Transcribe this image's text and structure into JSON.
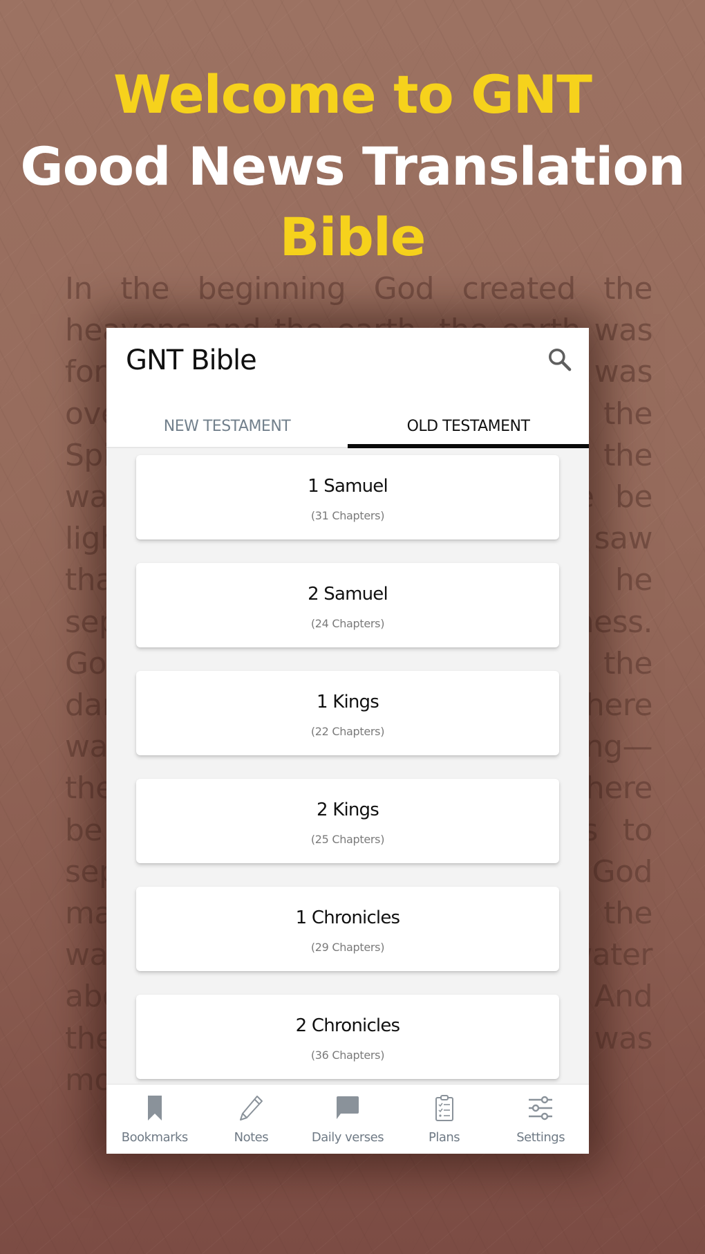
{
  "promo": {
    "line1": "Welcome to GNT",
    "line2": "Good News Translation",
    "line3": "Bible",
    "accent_color": "#f6d21c",
    "background_verse": "In the beginning God created the heavens and the earth, the earth was formless and empty, darkness was over the surface of the deep, and the Spirit of God was hovering over the waters. And God said, Let there be light, and there was light. God saw that the light was good, and he separated the light from the darkness. God called the light day, and the darkness he called night. And there was evening, and there was morning—the first day. And God said, Let there be a vault between the waters to separate water from water. So God made the vault and separated the water under the vault from the water above it. God called the vault sky. And there was evening, and there was morning—the second day."
  },
  "app": {
    "title": "GNT Bible",
    "search_icon": "search-icon",
    "tabs": [
      {
        "label": "NEW TESTAMENT",
        "active": false
      },
      {
        "label": "OLD TESTAMENT",
        "active": true
      }
    ],
    "books": [
      {
        "name": "1 Samuel",
        "chapters": "(31 Chapters)"
      },
      {
        "name": "2 Samuel",
        "chapters": "(24 Chapters)"
      },
      {
        "name": "1 Kings",
        "chapters": "(22 Chapters)"
      },
      {
        "name": "2 Kings",
        "chapters": "(25 Chapters)"
      },
      {
        "name": "1 Chronicles",
        "chapters": "(29 Chapters)"
      },
      {
        "name": "2 Chronicles",
        "chapters": "(36 Chapters)"
      }
    ],
    "bottom_nav": [
      {
        "label": "Bookmarks",
        "icon": "bookmark-icon"
      },
      {
        "label": "Notes",
        "icon": "pencil-icon"
      },
      {
        "label": "Daily verses",
        "icon": "chat-bubble-icon"
      },
      {
        "label": "Plans",
        "icon": "clipboard-checklist-icon"
      },
      {
        "label": "Settings",
        "icon": "sliders-icon"
      }
    ]
  }
}
